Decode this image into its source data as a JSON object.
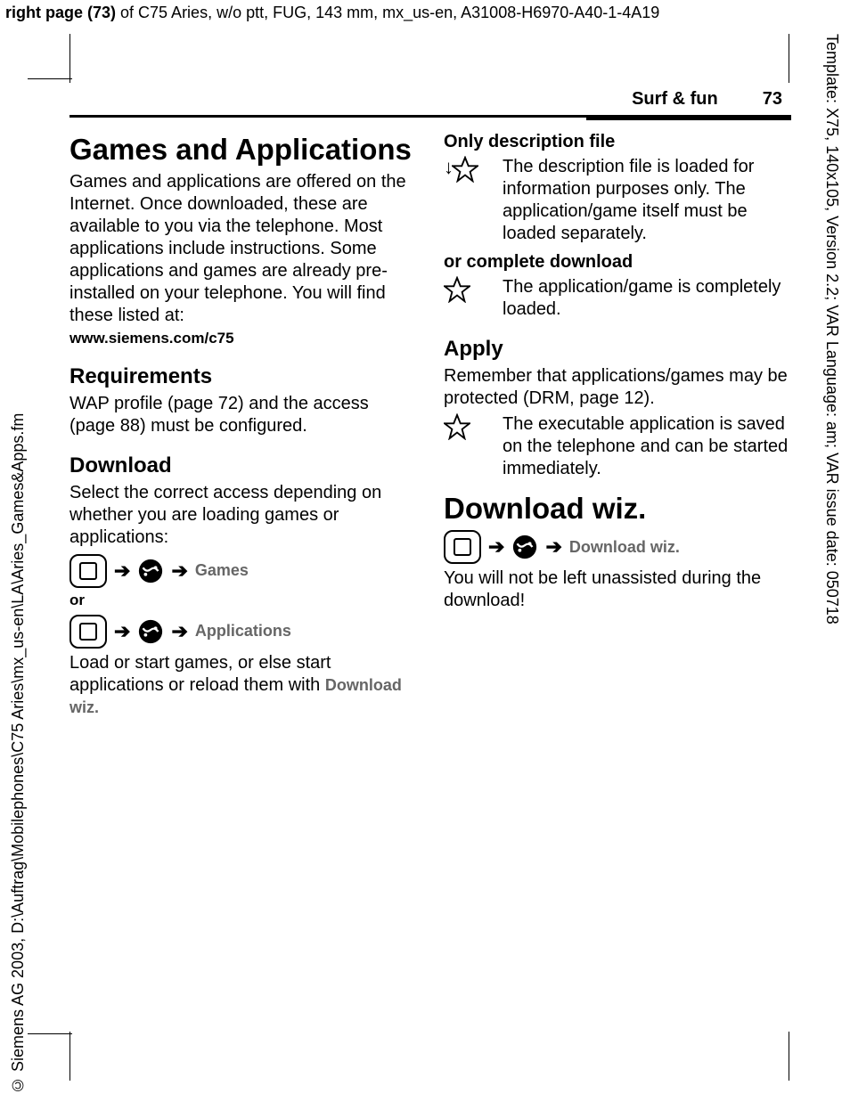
{
  "topHeader": {
    "boldPart": "right page (73)",
    "rest": " of C75 Aries, w/o ptt, FUG, 143 mm, mx_us-en, A31008-H6970-A40-1-4A19"
  },
  "sideRight": "Template: X75, 140x105, Version 2.2; VAR Language: am; VAR issue date: 050718",
  "sideLeft": "© Siemens AG 2003, D:\\Auftrag\\Mobilephones\\C75 Aries\\mx_us-en\\LA\\Aries_Games&Apps.fm",
  "running": {
    "section": "Surf & fun",
    "page": "73"
  },
  "left": {
    "h1": "Games and Applications",
    "intro": "Games and applications are offered on the Internet. Once downloaded, these are available to you via the telephone. Most applications include instructions. Some applications and games are already pre-installed on your telephone. You will find these listed at:",
    "introLink": "www.siemens.com/c75",
    "reqHeading": "Requirements",
    "reqText": "WAP profile (page 72) and the access (page 88) must be configured.",
    "dlHeading": "Download",
    "dlText": "Select the correct access depending on whether you are loading games or applications:",
    "nav1Label": "Games",
    "orLabel": "or",
    "nav2Label": "Applications",
    "afterNav1": "Load or start games, or else start applications or reload them with ",
    "afterNav2": "Download wiz."
  },
  "right": {
    "onlyDesc": "Only description file",
    "onlyDescText": "The description file is loaded for information purposes only. The application/game itself must be loaded separately.",
    "orComplete": "or complete download",
    "orCompleteText": "The application/game is completely loaded.",
    "applyHeading": "Apply",
    "applyText": "Remember that applications/games may be protected (DRM, page 12).",
    "applyEntryText": "The executable application is saved on the telephone and can be started immediately.",
    "dlwizH1": "Download wiz.",
    "dlwizNavLabel": "Download wiz.",
    "dlwizText": "You will not be left unassisted during the download!"
  }
}
